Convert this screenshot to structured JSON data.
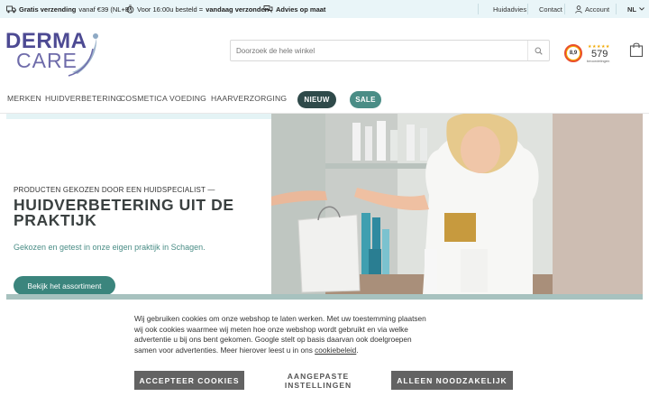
{
  "topbar": {
    "usp1_strong": "Gratis verzending",
    "usp1_rest": "vanaf €39 (NL+B)",
    "usp2_rest": "Voor 16:00u besteld =",
    "usp2_strong": "vandaag verzonden",
    "usp3_strong": "Advies op maat",
    "link_huidadvies": "Huidadvies",
    "link_contact": "Contact",
    "link_account": "Account",
    "lang": "NL"
  },
  "logo": {
    "line1": "DERMA",
    "line2": "CARE"
  },
  "search": {
    "placeholder": "Doorzoek de hele winkel"
  },
  "rating": {
    "score": "8,9",
    "stars": "★★★★★",
    "count": "579",
    "label": "beoordelingen"
  },
  "nav": {
    "items": [
      "MERKEN",
      "HUIDVERBETERING",
      "COSMETICA",
      "VOEDING",
      "HAARVERZORGING"
    ],
    "new_label": "NIEUW",
    "sale_label": "SALE"
  },
  "hero": {
    "subtitle": "PRODUCTEN GEKOZEN DOOR EEN HUIDSPECIALIST —",
    "title": "HUIDVERBETERING UIT DE PRAKTIJK",
    "description": "Gekozen en getest in onze eigen praktijk in Schagen.",
    "cta": "Bekijk het assortiment"
  },
  "cookie": {
    "text": "Wij gebruiken cookies om onze webshop te laten werken. Met uw toestemming plaatsen wij ook cookies waarmee wij meten hoe onze webshop wordt gebruikt en via welke advertentie u bij ons bent gekomen. Google stelt op basis daarvan ook doelgroepen samen voor advertenties. Meer hierover leest u in ons",
    "link": "cookiebeleid",
    "end": ".",
    "accept": "ACCEPTEER COOKIES",
    "custom": "AANGEPASTE INSTELLINGEN",
    "necessary": "ALLEEN NOODZAKELIJK"
  }
}
